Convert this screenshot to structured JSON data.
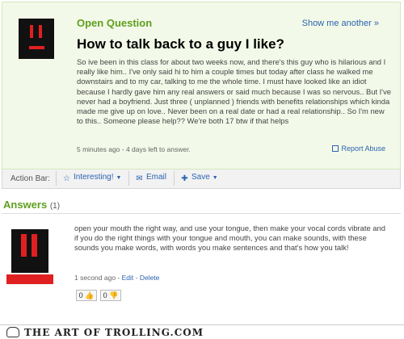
{
  "question": {
    "type_label": "Open Question",
    "show_more": "Show me another »",
    "title": "How to talk back to a guy I like?",
    "body": "So ive been in this class for about two weeks now, and there's this guy who is hilarious and I really like him.. I've only said hi to him a couple times but today after class he walked me downstairs and to my car, talking to me the whole time. I must have looked like an idiot because I hardly gave him any real answers or said much because I was so nervous.. But I've never had a boyfriend. Just three ( unplanned ) friends with benefits relationships which kinda made me give up on love.. Never been on a real date or had a real relationship.. So I'm new to this.. Someone please help?? We're both 17 btw if that helps",
    "meta": "5 minutes ago - 4 days left to answer.",
    "report": "Report Abuse"
  },
  "action_bar": {
    "label": "Action Bar:",
    "interesting": "Interesting!",
    "email": "Email",
    "save": "Save"
  },
  "answers": {
    "heading": "Answers",
    "count": "(1)",
    "items": [
      {
        "body": "open your mouth the right way, and use your tongue, then make your vocal cords vibrate and if you do the right things with your tongue and mouth, you can make sounds, with these sounds you make words, with words you make sentences and that's how you talk!",
        "time": "1 second ago",
        "edit": "Edit",
        "delete": "Delete",
        "thumbs_up": "0 👍",
        "thumbs_down": "0 👎"
      }
    ]
  },
  "watermark": "THE ART OF TROLLING.COM",
  "colors": {
    "accent_green": "#5f9f1f",
    "link_blue": "#2b63b0",
    "avatar_red": "#e02020"
  }
}
